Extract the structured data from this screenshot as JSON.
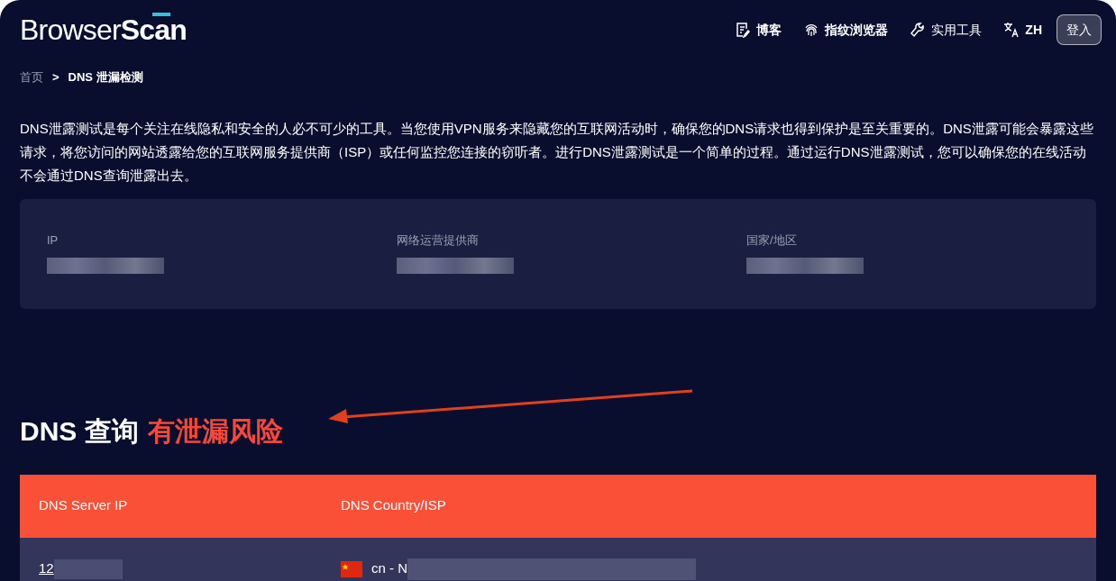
{
  "header": {
    "logo_light": "Browser",
    "logo_bold": "Scan",
    "nav": [
      {
        "kind": "blog",
        "label": "博客",
        "bold": true
      },
      {
        "kind": "fingerprint",
        "label": "指纹浏览器",
        "bold": true
      },
      {
        "kind": "tools",
        "label": "实用工具",
        "bold": false
      },
      {
        "kind": "language",
        "label": "ZH",
        "bold": true
      }
    ],
    "login": "登入"
  },
  "breadcrumb": {
    "items": [
      "首页",
      "DNS 泄漏检测"
    ],
    "separator": ">"
  },
  "intro": "DNS泄露测试是每个关注在线隐私和安全的人必不可少的工具。当您使用VPN服务来隐藏您的互联网活动时，确保您的DNS请求也得到保护是至关重要的。DNS泄露可能会暴露这些请求，将您访问的网站透露给您的互联网服务提供商（ISP）或任何监控您连接的窃听者。进行DNS泄露测试是一个简单的过程。通过运行DNS泄露测试，您可以确保您的在线活动不会通过DNS查询泄露出去。",
  "info_card": {
    "fields": [
      {
        "label": "IP",
        "redacted": true
      },
      {
        "label": "网络运营提供商",
        "redacted": true
      },
      {
        "label": "国家/地区",
        "redacted": true
      }
    ]
  },
  "dns_query": {
    "title": "DNS 查询",
    "status": "有泄漏风险",
    "leak": true
  },
  "table": {
    "columns": [
      "DNS Server IP",
      "DNS Country/ISP"
    ],
    "rows": [
      {
        "ip": "12",
        "country": "cn - N"
      }
    ]
  }
}
